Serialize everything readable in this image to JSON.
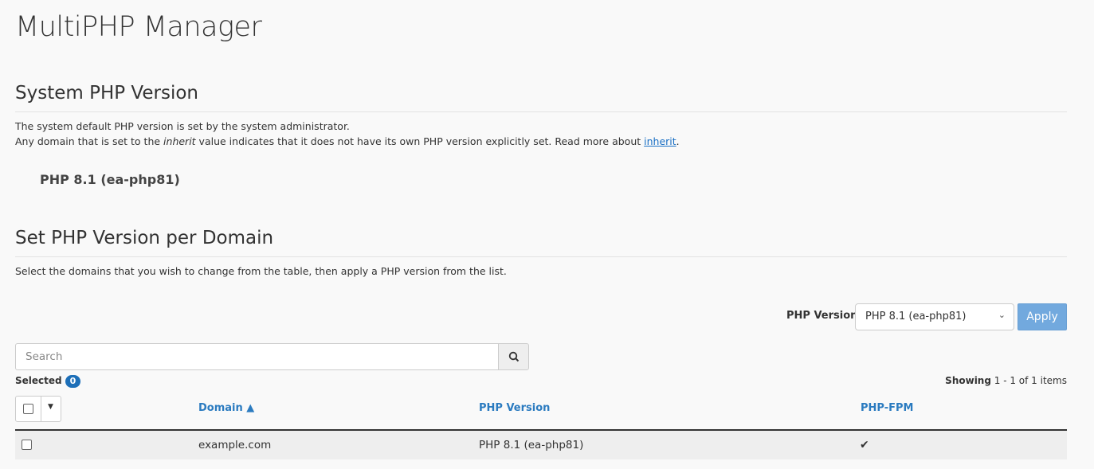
{
  "page_title": "MultiPHP Manager",
  "system": {
    "heading": "System PHP Version",
    "line1": "The system default PHP version is set by the system administrator.",
    "line2_pre": "Any domain that is set to the ",
    "line2_em": "inherit",
    "line2_mid": " value indicates that it does not have its own PHP version explicitly set. Read more about ",
    "line2_link": "inherit",
    "line2_post": ".",
    "version": "PHP 8.1 (ea-php81)"
  },
  "per_domain": {
    "heading": "Set PHP Version per Domain",
    "description": "Select the domains that you wish to change from the table, then apply a PHP version from the list.",
    "php_version_label": "PHP Version",
    "php_version_selected": "PHP 8.1 (ea-php81)",
    "apply_label": "Apply",
    "search_placeholder": "Search",
    "selected_label": "Selected",
    "selected_count": "0",
    "showing_bold": "Showing",
    "showing_rest": " 1 - 1 of 1 items"
  },
  "table": {
    "columns": [
      "Domain ▲",
      "PHP Version",
      "PHP-FPM"
    ],
    "rows": [
      {
        "domain": "example.com",
        "php_version": "PHP 8.1 (ea-php81)",
        "php_fpm": "✔"
      }
    ]
  },
  "colors": {
    "accent": "#2b7bc0",
    "apply": "#72a9de",
    "badge": "#1d6fb8"
  }
}
